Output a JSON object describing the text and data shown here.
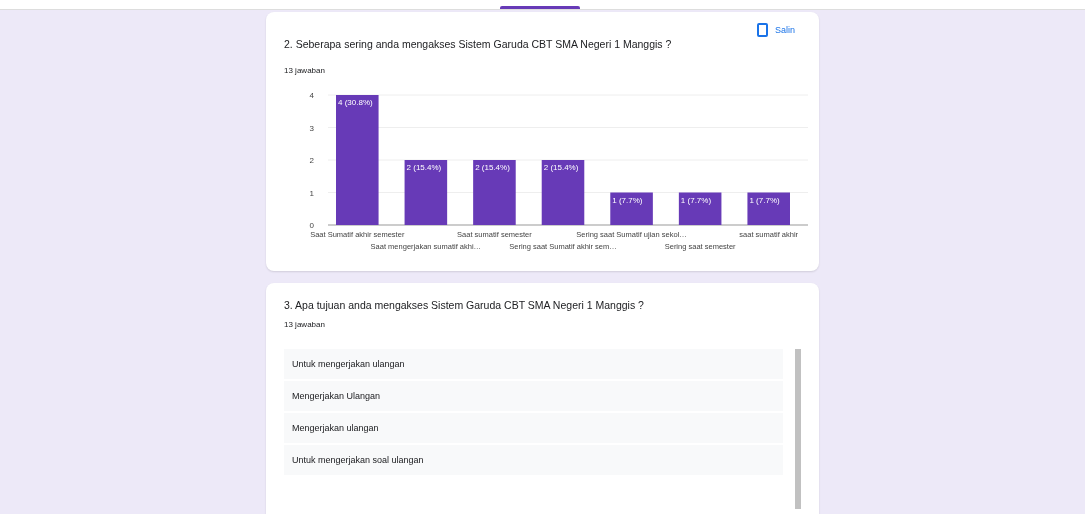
{
  "questions": [
    {
      "kind": "chart",
      "title": "2. Seberapa sering anda mengakses  Sistem Garuda CBT SMA Negeri 1 Manggis  ?",
      "count": "13 jawaban",
      "copy_label": "Salin",
      "chart_data": {
        "type": "bar",
        "categories": [
          "Saat Sumatif akhir semester",
          "Saat mengerjakan sumatif akhi…",
          "Saat sumatif semester",
          "Sering saat Sumatif akhir sem…",
          "Sering saat Sumatif ujian sekol…",
          "Sering saat semester",
          "saat sumatif akhir"
        ],
        "series": [
          {
            "color": "#673ab7",
            "values": [
              4,
              2,
              2,
              2,
              1,
              1,
              1
            ]
          }
        ],
        "grid": true,
        "ylim": [
          0,
          4
        ],
        "yticks": [
          0,
          1,
          2,
          3,
          4
        ],
        "value_labels": [
          "4 (30.8%)",
          "2 (15.4%)",
          "2 (15.4%)",
          "2 (15.4%)",
          "1 (7.7%)",
          "1 (7.7%)",
          "1 (7.7%)"
        ]
      }
    },
    {
      "kind": "list",
      "title": "3. Apa tujuan anda mengakses  Sistem Garuda CBT SMA Negeri 1 Manggis  ?",
      "count": "13 jawaban",
      "answers": [
        "Untuk mengerjakan ulangan",
        "Mengerjakan Ulangan",
        "Mengerjakan ulangan",
        "Untuk mengerjakan soal ulangan"
      ]
    }
  ]
}
